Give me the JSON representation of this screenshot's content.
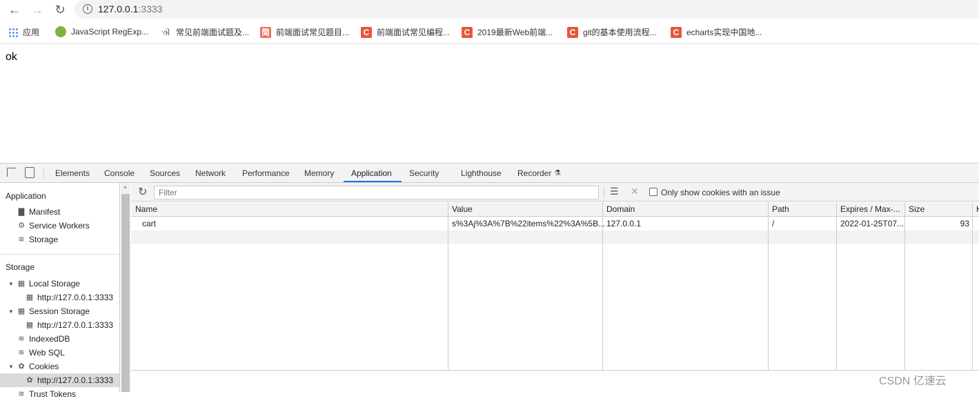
{
  "browser": {
    "url_host": "127.0.0.1",
    "url_port": ":3333",
    "bookmarks": [
      {
        "label": "应用",
        "icon": "apps-grid-icon"
      },
      {
        "label": "JavaScript RegExp...",
        "icon": "favicon",
        "color": "#7cb342"
      },
      {
        "label": "常见前端面试题及...",
        "icon": "favicon"
      },
      {
        "label": "前端面试常见题目...",
        "icon": "jianshu-favicon",
        "glyph": "简",
        "color": "#ea6f5a"
      },
      {
        "label": "前端面试常见编程...",
        "icon": "csdn-favicon",
        "glyph": "C",
        "color": "#e8553f"
      },
      {
        "label": "2019最新Web前端...",
        "icon": "csdn-favicon",
        "glyph": "C",
        "color": "#e8553f"
      },
      {
        "label": "git的基本使用流程...",
        "icon": "csdn-favicon",
        "glyph": "C",
        "color": "#e8553f"
      },
      {
        "label": "echarts实现中国地...",
        "icon": "csdn-favicon",
        "glyph": "C",
        "color": "#e8553f"
      }
    ]
  },
  "page": {
    "text": "ok"
  },
  "devtools": {
    "tabs": [
      "Elements",
      "Console",
      "Sources",
      "Network",
      "Performance",
      "Memory",
      "Application",
      "Security",
      "Lighthouse",
      "Recorder"
    ],
    "active_tab": "Application",
    "sidebar": {
      "app_header": "Application",
      "app_items": [
        "Manifest",
        "Service Workers",
        "Storage"
      ],
      "storage_header": "Storage",
      "storage_items": [
        {
          "label": "Local Storage",
          "icon": "grid-icon",
          "expanded": true
        },
        {
          "label": "http://127.0.0.1:3333",
          "icon": "grid-icon",
          "child": true
        },
        {
          "label": "Session Storage",
          "icon": "grid-icon",
          "expanded": true
        },
        {
          "label": "http://127.0.0.1:3333",
          "icon": "grid-icon",
          "child": true
        },
        {
          "label": "IndexedDB",
          "icon": "database-icon"
        },
        {
          "label": "Web SQL",
          "icon": "database-icon"
        },
        {
          "label": "Cookies",
          "icon": "cookie-icon",
          "expanded": true
        },
        {
          "label": "http://127.0.0.1:3333",
          "icon": "cookie-icon",
          "child": true,
          "selected": true
        },
        {
          "label": "Trust Tokens",
          "icon": "database-icon"
        }
      ]
    },
    "toolbar": {
      "filter_placeholder": "Filter",
      "checkbox_label": "Only show cookies with an issue"
    },
    "table": {
      "columns": [
        "Name",
        "Value",
        "Domain",
        "Path",
        "Expires / Max-...",
        "Size",
        "H"
      ],
      "rows": [
        [
          "cart",
          "s%3Aj%3A%7B%22items%22%3A%5B...",
          "127.0.0.1",
          "/",
          "2022-01-25T07...",
          "93",
          ""
        ]
      ]
    }
  },
  "watermark": "CSDN  亿速云"
}
